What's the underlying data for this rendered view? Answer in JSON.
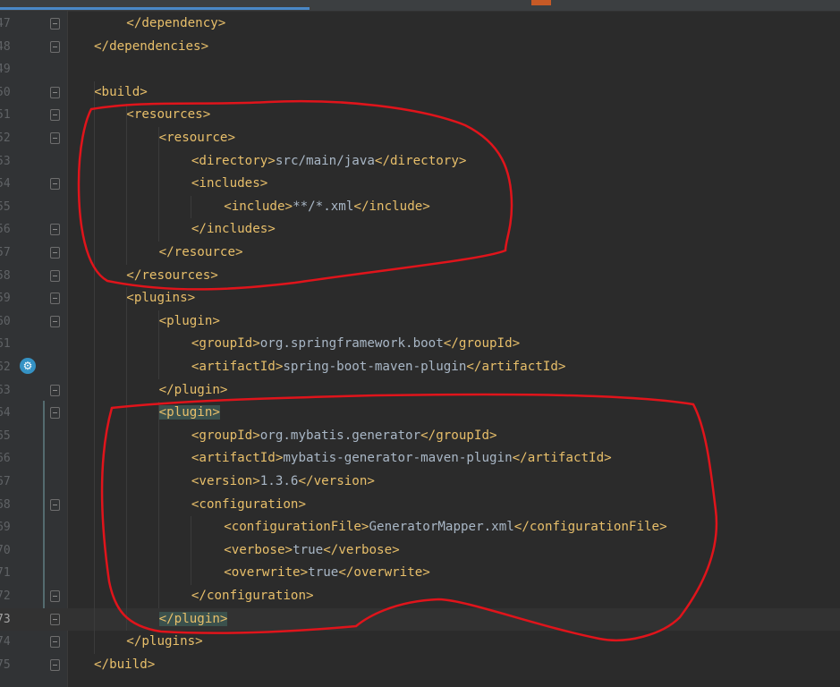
{
  "editor": {
    "current_line": "73",
    "lines": [
      {
        "num": "47",
        "indent": 1,
        "parts": [
          {
            "t": "</dependency>",
            "k": "tag"
          }
        ]
      },
      {
        "num": "48",
        "indent": 0,
        "parts": [
          {
            "t": "</dependencies>",
            "k": "tag"
          }
        ]
      },
      {
        "num": "49",
        "indent": 0,
        "parts": []
      },
      {
        "num": "50",
        "indent": 0,
        "parts": [
          {
            "t": "<build>",
            "k": "tag"
          }
        ]
      },
      {
        "num": "51",
        "indent": 1,
        "parts": [
          {
            "t": "<resources>",
            "k": "tag"
          }
        ]
      },
      {
        "num": "52",
        "indent": 2,
        "parts": [
          {
            "t": "<resource>",
            "k": "tag"
          }
        ]
      },
      {
        "num": "53",
        "indent": 3,
        "parts": [
          {
            "t": "<directory>",
            "k": "tag"
          },
          {
            "t": "src/main/java",
            "k": "txt"
          },
          {
            "t": "</directory>",
            "k": "tag"
          }
        ]
      },
      {
        "num": "54",
        "indent": 3,
        "parts": [
          {
            "t": "<includes>",
            "k": "tag"
          }
        ]
      },
      {
        "num": "55",
        "indent": 4,
        "parts": [
          {
            "t": "<include>",
            "k": "tag"
          },
          {
            "t": "**/*.xml",
            "k": "txt"
          },
          {
            "t": "</include>",
            "k": "tag"
          }
        ]
      },
      {
        "num": "56",
        "indent": 3,
        "parts": [
          {
            "t": "</includes>",
            "k": "tag"
          }
        ]
      },
      {
        "num": "57",
        "indent": 2,
        "parts": [
          {
            "t": "</resource>",
            "k": "tag"
          }
        ]
      },
      {
        "num": "58",
        "indent": 1,
        "parts": [
          {
            "t": "</resources>",
            "k": "tag"
          }
        ]
      },
      {
        "num": "59",
        "indent": 1,
        "parts": [
          {
            "t": "<plugins>",
            "k": "tag"
          }
        ]
      },
      {
        "num": "60",
        "indent": 2,
        "parts": [
          {
            "t": "<plugin>",
            "k": "tag"
          }
        ]
      },
      {
        "num": "61",
        "indent": 3,
        "parts": [
          {
            "t": "<groupId>",
            "k": "tag"
          },
          {
            "t": "org.springframework.boot",
            "k": "txt"
          },
          {
            "t": "</groupId>",
            "k": "tag"
          }
        ]
      },
      {
        "num": "62",
        "indent": 3,
        "parts": [
          {
            "t": "<artifactId>",
            "k": "tag"
          },
          {
            "t": "spring-boot-maven-plugin",
            "k": "txt"
          },
          {
            "t": "</artifactId>",
            "k": "tag"
          }
        ]
      },
      {
        "num": "63",
        "indent": 2,
        "parts": [
          {
            "t": "</plugin>",
            "k": "tag"
          }
        ]
      },
      {
        "num": "64",
        "indent": 2,
        "parts": [
          {
            "t": "<plugin>",
            "k": "tag hl"
          }
        ]
      },
      {
        "num": "65",
        "indent": 3,
        "parts": [
          {
            "t": "<groupId>",
            "k": "tag"
          },
          {
            "t": "org.mybatis.generator",
            "k": "txt"
          },
          {
            "t": "</groupId>",
            "k": "tag"
          }
        ]
      },
      {
        "num": "66",
        "indent": 3,
        "parts": [
          {
            "t": "<artifactId>",
            "k": "tag"
          },
          {
            "t": "mybatis-generator-maven-plugin",
            "k": "txt"
          },
          {
            "t": "</artifactId>",
            "k": "tag"
          }
        ]
      },
      {
        "num": "67",
        "indent": 3,
        "parts": [
          {
            "t": "<version>",
            "k": "tag"
          },
          {
            "t": "1.3.6",
            "k": "txt"
          },
          {
            "t": "</version>",
            "k": "tag"
          }
        ]
      },
      {
        "num": "68",
        "indent": 3,
        "parts": [
          {
            "t": "<configuration>",
            "k": "tag"
          }
        ]
      },
      {
        "num": "69",
        "indent": 4,
        "parts": [
          {
            "t": "<configurationFile>",
            "k": "tag"
          },
          {
            "t": "GeneratorMapper.xml",
            "k": "txt"
          },
          {
            "t": "</configurationFile>",
            "k": "tag"
          }
        ]
      },
      {
        "num": "70",
        "indent": 4,
        "parts": [
          {
            "t": "<verbose>",
            "k": "tag"
          },
          {
            "t": "true",
            "k": "txt"
          },
          {
            "t": "</verbose>",
            "k": "tag"
          }
        ]
      },
      {
        "num": "71",
        "indent": 4,
        "parts": [
          {
            "t": "<overwrite>",
            "k": "tag"
          },
          {
            "t": "true",
            "k": "txt"
          },
          {
            "t": "</overwrite>",
            "k": "tag"
          }
        ]
      },
      {
        "num": "72",
        "indent": 3,
        "parts": [
          {
            "t": "</configuration>",
            "k": "tag"
          }
        ]
      },
      {
        "num": "73",
        "indent": 2,
        "parts": [
          {
            "t": "</plugin>",
            "k": "tag hl"
          }
        ]
      },
      {
        "num": "74",
        "indent": 1,
        "parts": [
          {
            "t": "</plugins>",
            "k": "tag"
          }
        ]
      },
      {
        "num": "75",
        "indent": 0,
        "parts": [
          {
            "t": "</build>",
            "k": "tag"
          }
        ]
      }
    ],
    "fold_lines": [
      "47",
      "48",
      "50",
      "51",
      "52",
      "54",
      "56",
      "57",
      "58",
      "59",
      "60",
      "63",
      "64",
      "68",
      "72",
      "73",
      "74",
      "75"
    ]
  },
  "gutter_icon": "run-gear-icon",
  "colors": {
    "background": "#2b2b2b",
    "tag": "#e8bf6a",
    "text": "#a9b7c6",
    "annotation": "#e0141b"
  }
}
